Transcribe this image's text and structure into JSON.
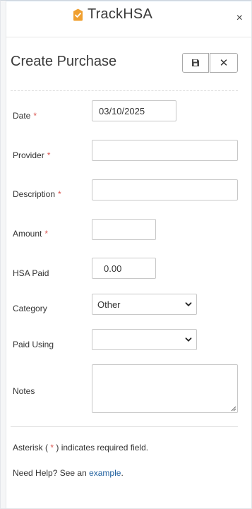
{
  "app": {
    "brand_name": "TrackHSA",
    "close_glyph": "×"
  },
  "page": {
    "title": "Create Purchase",
    "save_icon": "save-icon",
    "cancel_glyph": "✕"
  },
  "form": {
    "date": {
      "label": "Date",
      "value": "03/10/2025",
      "required": true
    },
    "provider": {
      "label": "Provider",
      "value": "",
      "required": true
    },
    "description": {
      "label": "Description",
      "value": "",
      "required": true
    },
    "amount": {
      "label": "Amount",
      "value": "",
      "required": true
    },
    "hsa_paid": {
      "label": "HSA Paid",
      "value": "0.00",
      "required": false
    },
    "category": {
      "label": "Category",
      "selected": "Other"
    },
    "paid_using": {
      "label": "Paid Using",
      "selected": ""
    },
    "notes": {
      "label": "Notes",
      "value": ""
    },
    "required_mark": "*"
  },
  "footer": {
    "asterisk_prefix": "Asterisk (",
    "asterisk_mark": "*",
    "asterisk_suffix": ") indicates required field.",
    "help_prefix": "Need Help? See an ",
    "help_link": "example",
    "help_suffix": "."
  },
  "colors": {
    "brand_orange": "#f0a030",
    "required_red": "#d9534f",
    "link_blue": "#1f5f9e"
  }
}
